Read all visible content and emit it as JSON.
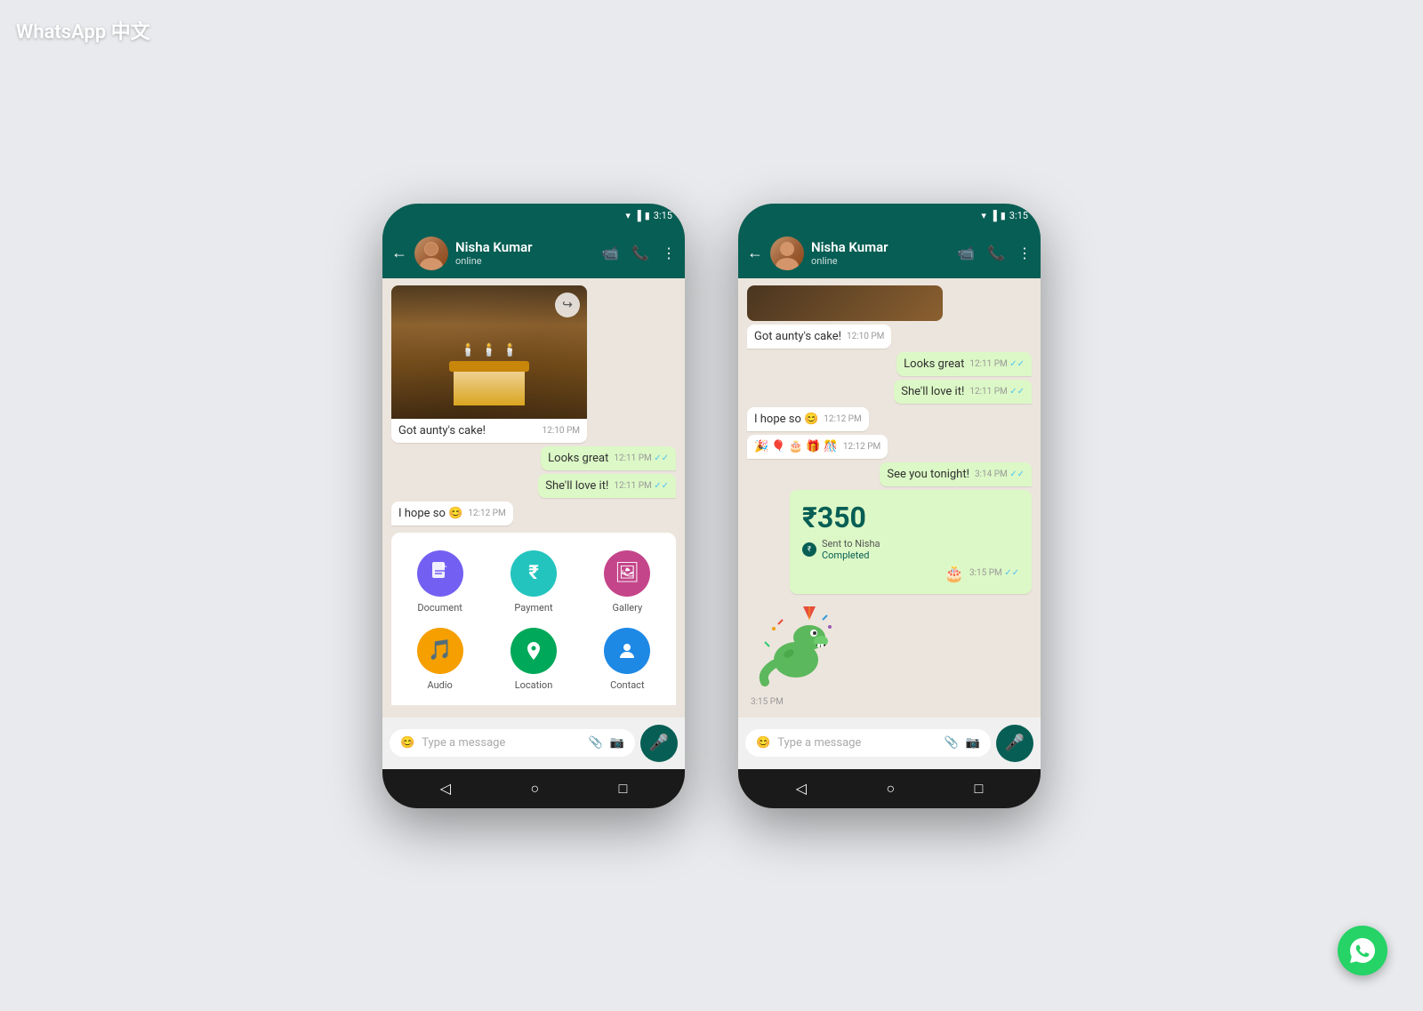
{
  "watermark": "WhatsApp 中文",
  "phone1": {
    "statusBar": {
      "time": "3:15",
      "icons": [
        "wifi",
        "signal",
        "battery"
      ]
    },
    "header": {
      "contactName": "Nisha Kumar",
      "status": "online",
      "backLabel": "←",
      "videoIcon": "📹",
      "callIcon": "📞",
      "moreIcon": "⋮"
    },
    "messages": [
      {
        "type": "image",
        "direction": "incoming",
        "caption": "Got aunty's cake!",
        "time": "12:10 PM"
      },
      {
        "type": "text",
        "direction": "outgoing",
        "text": "Looks great",
        "time": "12:11 PM",
        "ticks": "✓✓"
      },
      {
        "type": "text",
        "direction": "outgoing",
        "text": "She'll love it!",
        "time": "12:11 PM",
        "ticks": "✓✓"
      },
      {
        "type": "text",
        "direction": "incoming",
        "text": "I hope so 😊",
        "time": "12:12 PM"
      }
    ],
    "attachmentPanel": {
      "items": [
        {
          "id": "document",
          "label": "Document",
          "icon": "📄",
          "colorClass": "icon-document"
        },
        {
          "id": "payment",
          "label": "Payment",
          "icon": "₹",
          "colorClass": "icon-payment"
        },
        {
          "id": "gallery",
          "label": "Gallery",
          "icon": "🖼",
          "colorClass": "icon-gallery"
        },
        {
          "id": "audio",
          "label": "Audio",
          "icon": "🎵",
          "colorClass": "icon-audio"
        },
        {
          "id": "location",
          "label": "Location",
          "icon": "📍",
          "colorClass": "icon-location"
        },
        {
          "id": "contact",
          "label": "Contact",
          "icon": "👤",
          "colorClass": "icon-contact"
        }
      ]
    },
    "inputBar": {
      "placeholder": "Type a message",
      "emojiIcon": "😊",
      "attachIcon": "📎",
      "cameraIcon": "📷",
      "micIcon": "🎤"
    },
    "navBar": {
      "back": "◁",
      "home": "○",
      "recent": "□"
    }
  },
  "phone2": {
    "statusBar": {
      "time": "3:15"
    },
    "header": {
      "contactName": "Nisha Kumar",
      "status": "online"
    },
    "messages": [
      {
        "type": "image-partial",
        "direction": "incoming"
      },
      {
        "type": "text",
        "direction": "incoming",
        "text": "Got aunty's cake!",
        "time": "12:10 PM"
      },
      {
        "type": "text",
        "direction": "outgoing",
        "text": "Looks great",
        "time": "12:11 PM",
        "ticks": "✓✓"
      },
      {
        "type": "text",
        "direction": "outgoing",
        "text": "She'll love it!",
        "time": "12:11 PM",
        "ticks": "✓✓"
      },
      {
        "type": "text",
        "direction": "incoming",
        "text": "I hope so 😊",
        "time": "12:12 PM"
      },
      {
        "type": "emoji",
        "direction": "incoming",
        "text": "🎉 🎈 🎂 🎁 🎊",
        "time": "12:12 PM"
      },
      {
        "type": "text",
        "direction": "outgoing",
        "text": "See you tonight!",
        "time": "3:14 PM",
        "ticks": "✓✓"
      },
      {
        "type": "payment",
        "direction": "outgoing",
        "amount": "₹350",
        "sentTo": "Sent to Nisha",
        "statusText": "Completed",
        "time": "3:15 PM",
        "ticks": "✓✓"
      },
      {
        "type": "sticker",
        "direction": "incoming",
        "time": "3:15 PM"
      }
    ],
    "inputBar": {
      "placeholder": "Type a message"
    },
    "navBar": {
      "back": "◁",
      "home": "○",
      "recent": "□"
    }
  },
  "whatsappFab": {
    "icon": "💬"
  }
}
